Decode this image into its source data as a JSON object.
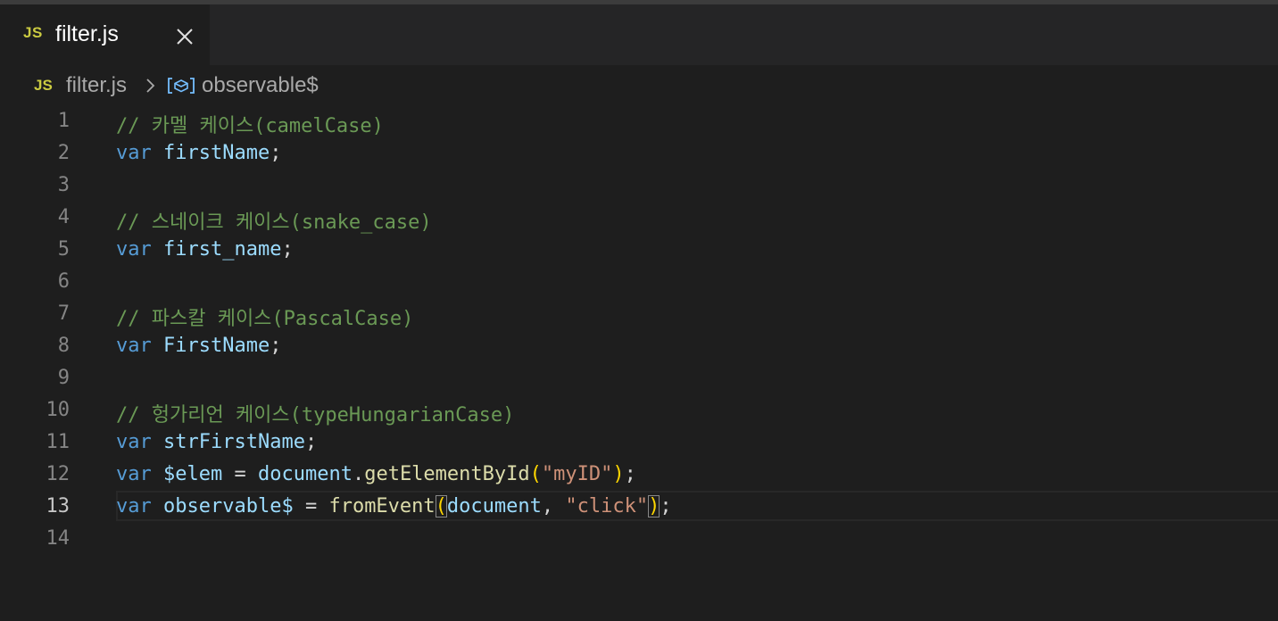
{
  "tab": {
    "icon_text": "JS",
    "label": "filter.js",
    "close_glyph": "close-icon"
  },
  "breadcrumb": {
    "icon_text": "JS",
    "file": "filter.js",
    "separator": "chevron-right-icon",
    "symbol_icon": "symbol-variable-icon",
    "symbol": "observable$"
  },
  "editor": {
    "active_line": 13,
    "lines": [
      {
        "number": "1",
        "tokens": [
          {
            "t": "// 카멜 케이스(camelCase)",
            "k": "comment"
          }
        ]
      },
      {
        "number": "2",
        "tokens": [
          {
            "t": "var",
            "k": "keyword"
          },
          {
            "t": " ",
            "k": "punct"
          },
          {
            "t": "firstName",
            "k": "var"
          },
          {
            "t": ";",
            "k": "punct"
          }
        ]
      },
      {
        "number": "3",
        "tokens": []
      },
      {
        "number": "4",
        "tokens": [
          {
            "t": "// 스네이크 케이스(snake_case)",
            "k": "comment"
          }
        ]
      },
      {
        "number": "5",
        "tokens": [
          {
            "t": "var",
            "k": "keyword"
          },
          {
            "t": " ",
            "k": "punct"
          },
          {
            "t": "first_name",
            "k": "var"
          },
          {
            "t": ";",
            "k": "punct"
          }
        ]
      },
      {
        "number": "6",
        "tokens": []
      },
      {
        "number": "7",
        "tokens": [
          {
            "t": "// 파스칼 케이스(PascalCase)",
            "k": "comment"
          }
        ]
      },
      {
        "number": "8",
        "tokens": [
          {
            "t": "var",
            "k": "keyword"
          },
          {
            "t": " ",
            "k": "punct"
          },
          {
            "t": "FirstName",
            "k": "var"
          },
          {
            "t": ";",
            "k": "punct"
          }
        ]
      },
      {
        "number": "9",
        "tokens": []
      },
      {
        "number": "10",
        "tokens": [
          {
            "t": "// 헝가리언 케이스(typeHungarianCase)",
            "k": "comment"
          }
        ]
      },
      {
        "number": "11",
        "tokens": [
          {
            "t": "var",
            "k": "keyword"
          },
          {
            "t": " ",
            "k": "punct"
          },
          {
            "t": "strFirstName",
            "k": "var"
          },
          {
            "t": ";",
            "k": "punct"
          }
        ]
      },
      {
        "number": "12",
        "tokens": [
          {
            "t": "var",
            "k": "keyword"
          },
          {
            "t": " ",
            "k": "punct"
          },
          {
            "t": "$elem",
            "k": "var"
          },
          {
            "t": " = ",
            "k": "punct"
          },
          {
            "t": "document",
            "k": "var"
          },
          {
            "t": ".",
            "k": "punct"
          },
          {
            "t": "getElementById",
            "k": "func"
          },
          {
            "t": "(",
            "k": "paren"
          },
          {
            "t": "\"myID\"",
            "k": "string"
          },
          {
            "t": ")",
            "k": "paren"
          },
          {
            "t": ";",
            "k": "punct"
          }
        ]
      },
      {
        "number": "13",
        "tokens": [
          {
            "t": "var",
            "k": "keyword"
          },
          {
            "t": " ",
            "k": "punct"
          },
          {
            "t": "observable$",
            "k": "var"
          },
          {
            "t": " = ",
            "k": "punct"
          },
          {
            "t": "fromEvent",
            "k": "func"
          },
          {
            "t": "(",
            "k": "paren",
            "m": true
          },
          {
            "t": "document",
            "k": "var"
          },
          {
            "t": ", ",
            "k": "punct"
          },
          {
            "t": "\"click\"",
            "k": "string"
          },
          {
            "t": ")",
            "k": "paren",
            "m": true
          },
          {
            "t": ";",
            "k": "punct"
          }
        ]
      },
      {
        "number": "14",
        "tokens": []
      }
    ]
  },
  "colors": {
    "background": "#1e1e1e",
    "tab_bar": "#252526",
    "js_icon": "#cbcb41",
    "comment": "#6a9955",
    "keyword": "#569cd6",
    "variable": "#9cdcfe",
    "function": "#dcdcaa",
    "string": "#ce9178",
    "bracket": "#ffd700"
  }
}
